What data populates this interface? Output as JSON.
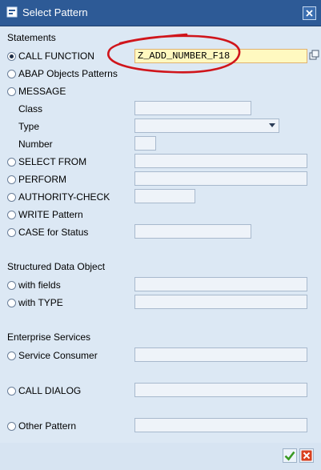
{
  "window": {
    "title": "Select Pattern"
  },
  "sections": {
    "statements": "Statements",
    "structured": "Structured Data Object",
    "enterprise": "Enterprise Services"
  },
  "options": {
    "call_function": "CALL FUNCTION",
    "abap_objects": "ABAP Objects Patterns",
    "message": "MESSAGE",
    "select_from": "SELECT FROM",
    "perform": "PERFORM",
    "authority_check": "AUTHORITY-CHECK",
    "write_pattern": "WRITE Pattern",
    "case_status": "CASE for Status",
    "with_fields": "with fields",
    "with_type": "with TYPE",
    "service_consumer": "Service Consumer",
    "call_dialog": "CALL DIALOG",
    "other_pattern": "Other Pattern"
  },
  "message_sub": {
    "class": "Class",
    "type": "Type",
    "number": "Number"
  },
  "fields": {
    "call_function_value": "Z_ADD_NUMBER_F18"
  },
  "selected_option": "call_function",
  "colors": {
    "title_bar": "#2d5a96",
    "panel": "#dce8f4",
    "active_field": "#fff9c0",
    "annotation": "#d0151b"
  }
}
